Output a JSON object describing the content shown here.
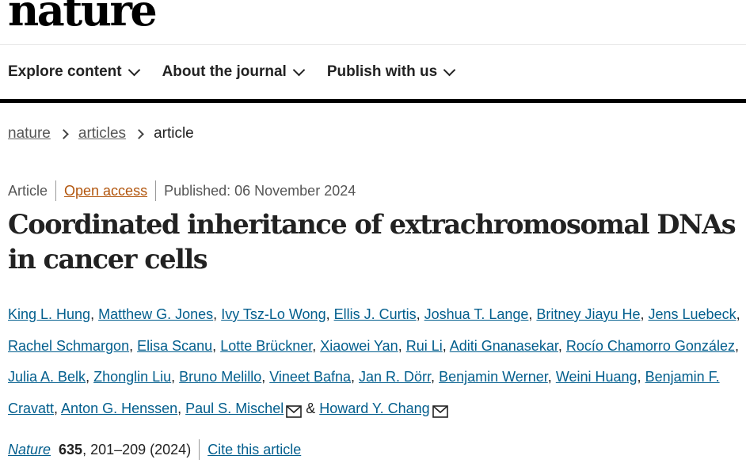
{
  "logo": "nature",
  "nav": {
    "items": [
      {
        "label": "Explore content"
      },
      {
        "label": "About the journal"
      },
      {
        "label": "Publish with us"
      }
    ]
  },
  "breadcrumb": {
    "items": [
      "nature",
      "articles"
    ],
    "current": "article"
  },
  "article": {
    "type": "Article",
    "access": "Open access",
    "published": "Published: 06 November 2024",
    "title_line1": "Coordinated inheritance of extrachromosomal DNAs",
    "title_line2": "in cancer cells"
  },
  "authors": [
    "King L. Hung",
    "Matthew G. Jones",
    "Ivy Tsz-Lo Wong",
    "Ellis J. Curtis",
    "Joshua T. Lange",
    "Britney Jiayu He",
    "Jens Luebeck",
    "Rachel Schmargon",
    "Elisa Scanu",
    "Lotte Brückner",
    "Xiaowei Yan",
    "Rui Li",
    "Aditi Gnanasekar",
    "Rocío Chamorro González",
    "Julia A. Belk",
    "Zhonglin Liu",
    "Bruno Melillo",
    "Vineet Bafna",
    "Jan R. Dörr",
    "Benjamin Werner",
    "Weini Huang",
    "Benjamin F. Cravatt",
    "Anton G. Henssen",
    "Paul S. Mischel",
    "Howard Y. Chang"
  ],
  "authors_separator": ", ",
  "authors_conjunction": " & ",
  "corresponding_icon": "envelope-icon",
  "citation": {
    "journal": "Nature",
    "volume": "635",
    "pages_year": ", 201–209 (2024)",
    "cite_label": "Cite this article"
  },
  "colors": {
    "link": "#025e8d",
    "open_access": "#b2560e",
    "text": "#222222",
    "muted": "#555555"
  }
}
